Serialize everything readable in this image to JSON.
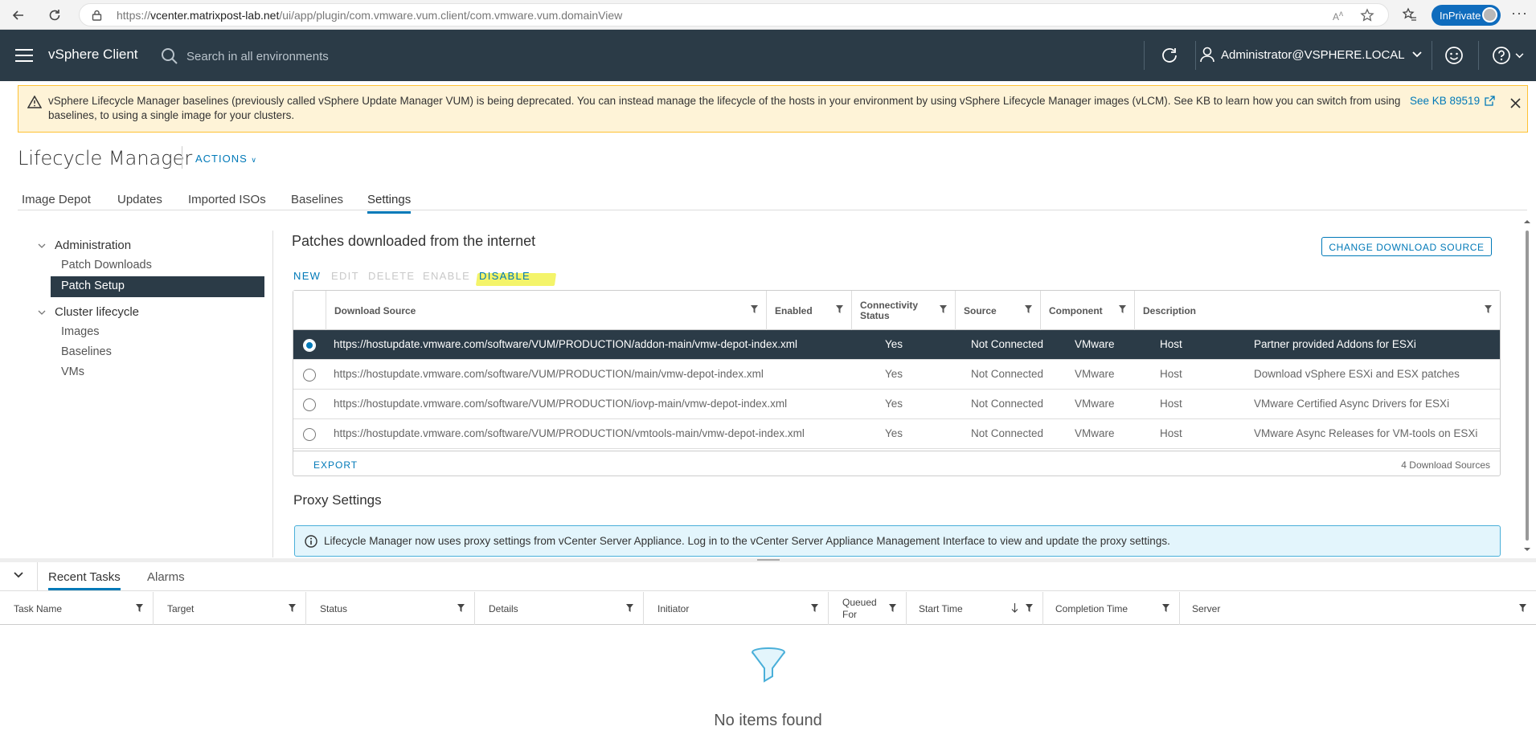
{
  "browser": {
    "url_prefix": "https://",
    "url_host": "vcenter.matrixpost-lab.net",
    "url_path": "/ui/app/plugin/com.vmware.vum.client/com.vmware.vum.domainView",
    "inprivate_label": "InPrivate"
  },
  "header": {
    "app_title": "vSphere Client",
    "search_placeholder": "Search in all environments",
    "user": "Administrator@VSPHERE.LOCAL"
  },
  "banner": {
    "text": "vSphere Lifecycle Manager baselines (previously called vSphere Update Manager VUM) is being deprecated. You can instead manage the lifecycle of the hosts in your environment by using vSphere Lifecycle Manager images (vLCM). See KB to learn how you can switch from using baselines, to using a single image for your clusters.",
    "link": "See KB 89519"
  },
  "page": {
    "title": "Lifecycle Manager",
    "actions_label": "ACTIONS"
  },
  "tabs": [
    {
      "label": "Image Depot"
    },
    {
      "label": "Updates"
    },
    {
      "label": "Imported ISOs"
    },
    {
      "label": "Baselines"
    },
    {
      "label": "Settings"
    }
  ],
  "sidebar": {
    "groups": [
      {
        "label": "Administration",
        "items": [
          "Patch Downloads",
          "Patch Setup"
        ]
      },
      {
        "label": "Cluster lifecycle",
        "items": [
          "Images",
          "Baselines",
          "VMs"
        ]
      }
    ],
    "selected": "Patch Setup"
  },
  "main": {
    "title": "Patches downloaded from the internet",
    "change_source_label": "CHANGE DOWNLOAD SOURCE",
    "toolbar": {
      "new": "NEW",
      "edit": "EDIT",
      "delete": "DELETE",
      "enable": "ENABLE",
      "disable": "DISABLE"
    },
    "highlight_color": "#f3f35a",
    "columns": [
      "Download Source",
      "Enabled",
      "Connectivity Status",
      "Source",
      "Component",
      "Description"
    ],
    "rows": [
      {
        "source": "https://hostupdate.vmware.com/software/VUM/PRODUCTION/addon-main/vmw-depot-index.xml",
        "enabled": "Yes",
        "status": "Not Connected",
        "type": "VMware",
        "component": "Host",
        "description": "Partner provided Addons for ESXi",
        "selected": true
      },
      {
        "source": "https://hostupdate.vmware.com/software/VUM/PRODUCTION/main/vmw-depot-index.xml",
        "enabled": "Yes",
        "status": "Not Connected",
        "type": "VMware",
        "component": "Host",
        "description": "Download vSphere ESXi and ESX patches",
        "selected": false
      },
      {
        "source": "https://hostupdate.vmware.com/software/VUM/PRODUCTION/iovp-main/vmw-depot-index.xml",
        "enabled": "Yes",
        "status": "Not Connected",
        "type": "VMware",
        "component": "Host",
        "description": "VMware Certified Async Drivers for ESXi",
        "selected": false
      },
      {
        "source": "https://hostupdate.vmware.com/software/VUM/PRODUCTION/vmtools-main/vmw-depot-index.xml",
        "enabled": "Yes",
        "status": "Not Connected",
        "type": "VMware",
        "component": "Host",
        "description": "VMware Async Releases for VM-tools on ESXi",
        "selected": false
      }
    ],
    "export_label": "EXPORT",
    "count_label": "4 Download Sources",
    "proxy_title": "Proxy Settings",
    "proxy_info": "Lifecycle Manager now uses proxy settings from vCenter Server Appliance. Log in to the vCenter Server Appliance Management Interface to view and update the proxy settings."
  },
  "bottom_panel": {
    "tabs": [
      "Recent Tasks",
      "Alarms"
    ],
    "columns": [
      "Task Name",
      "Target",
      "Status",
      "Details",
      "Initiator",
      "Queued For",
      "Start Time",
      "Completion Time",
      "Server"
    ],
    "empty_text": "No items found"
  },
  "colors": {
    "header_bg": "#2b3b47",
    "accent": "#0079b8",
    "warning_bg": "#fef3d7",
    "info_bg": "#e3f5fc"
  }
}
